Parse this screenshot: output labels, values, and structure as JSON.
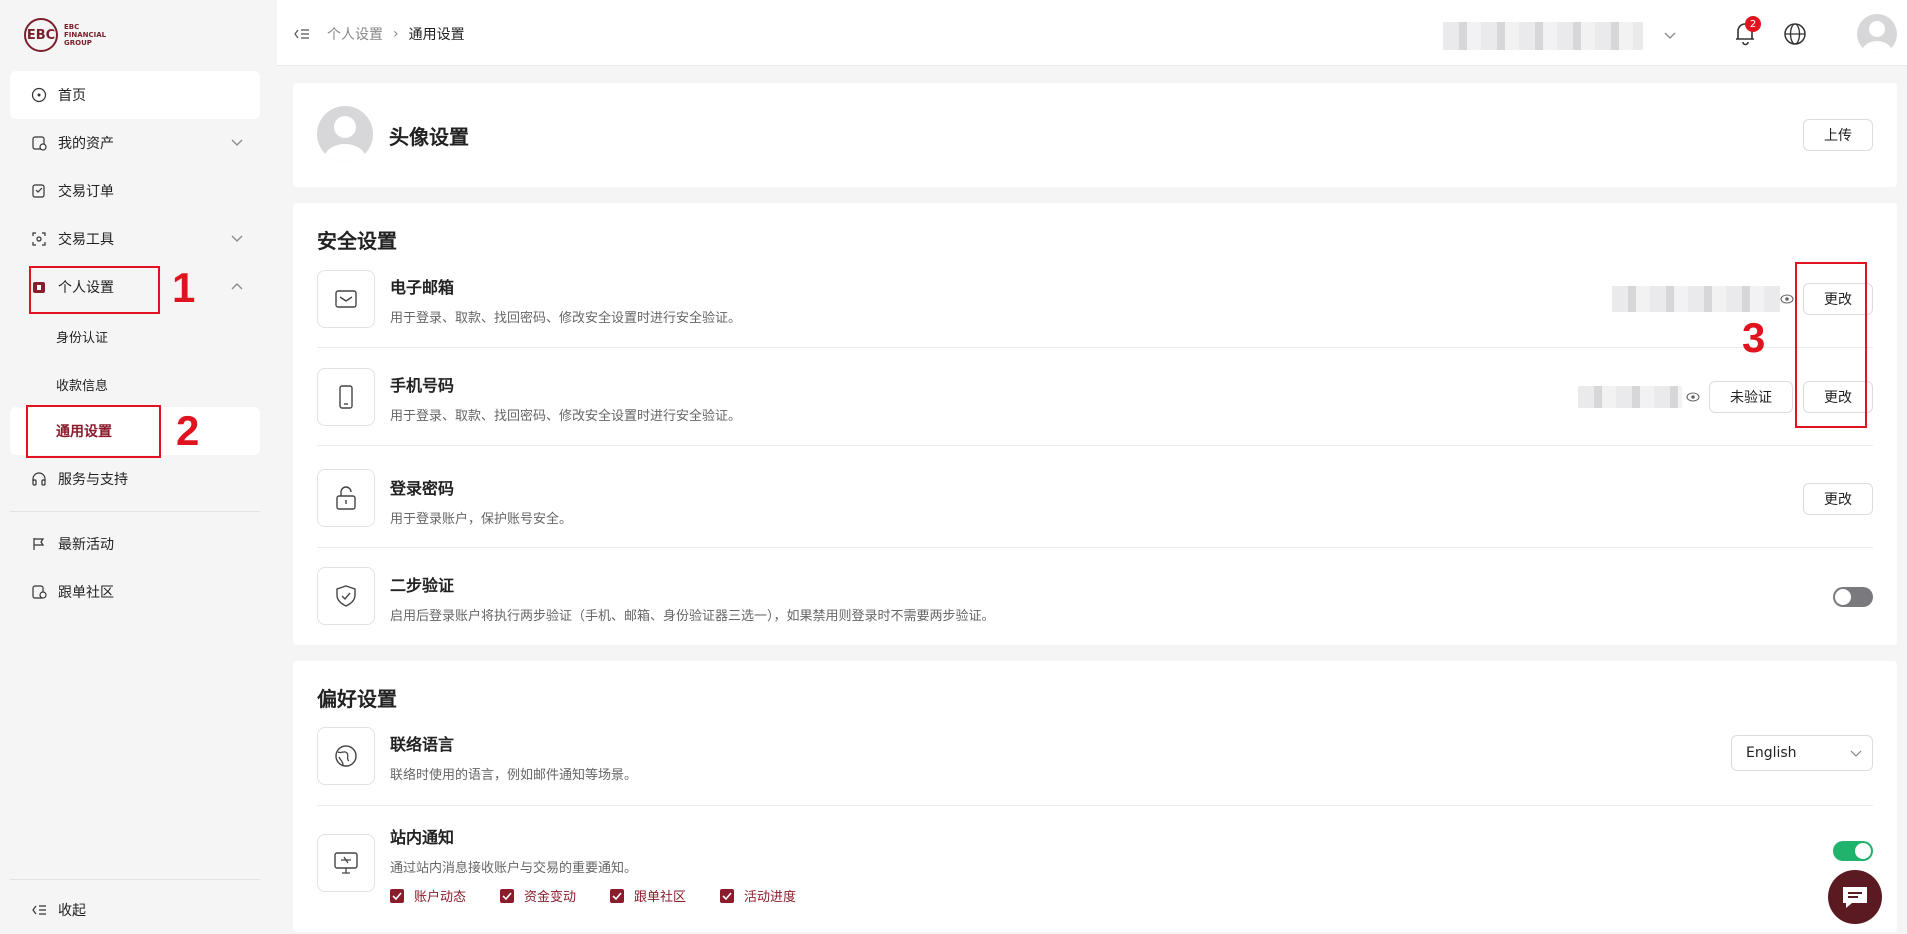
{
  "brand": {
    "logo_letters": "EBC",
    "logo_text": "EBC FINANCIAL GROUP"
  },
  "sidebar": {
    "items": [
      {
        "label": "首页"
      },
      {
        "label": "我的资产"
      },
      {
        "label": "交易订单"
      },
      {
        "label": "交易工具"
      },
      {
        "label": "个人设置"
      },
      {
        "label": "身份认证"
      },
      {
        "label": "收款信息"
      },
      {
        "label": "通用设置"
      },
      {
        "label": "服务与支持"
      },
      {
        "label": "最新活动"
      },
      {
        "label": "跟单社区"
      }
    ],
    "collapse_label": "收起"
  },
  "annotations": {
    "n1": "1",
    "n2": "2",
    "n3": "3"
  },
  "topbar": {
    "breadcrumb": [
      "个人设置",
      "通用设置"
    ],
    "notification_count": "2"
  },
  "avatar_section": {
    "title": "头像设置",
    "upload_label": "上传"
  },
  "security": {
    "title": "安全设置",
    "rows": [
      {
        "title": "电子邮箱",
        "desc": "用于登录、取款、找回密码、修改安全设置时进行安全验证。",
        "action": "更改"
      },
      {
        "title": "手机号码",
        "desc": "用于登录、取款、找回密码、修改安全设置时进行安全验证。",
        "status": "未验证",
        "action": "更改"
      },
      {
        "title": "登录密码",
        "desc": "用于登录账户，保护账号安全。",
        "action": "更改"
      },
      {
        "title": "二步验证",
        "desc": "启用后登录账户将执行两步验证（手机、邮箱、身份验证器三选一），如果禁用则登录时不需要两步验证。",
        "enabled": false
      }
    ]
  },
  "preferences": {
    "title": "偏好设置",
    "language": {
      "title": "联络语言",
      "desc": "联络时使用的语言，例如邮件通知等场景。",
      "value": "English"
    },
    "notify": {
      "title": "站内通知",
      "desc": "通过站内消息接收账户与交易的重要通知。",
      "enabled": true,
      "options": [
        "账户动态",
        "资金变动",
        "跟单社区",
        "活动进度"
      ]
    }
  },
  "colors": {
    "brand": "#8b1c2c",
    "annotation": "#e0141e",
    "toggle_on": "#1fb36b"
  }
}
